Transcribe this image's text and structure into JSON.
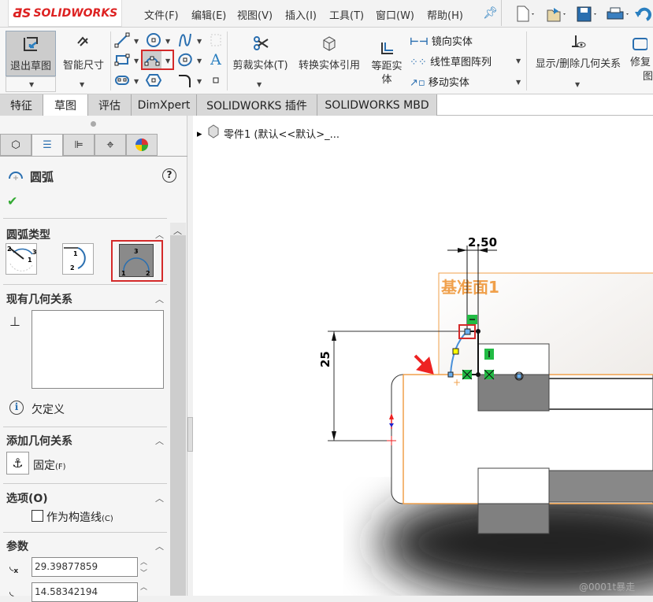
{
  "app": {
    "logo": "SOLIDWORKS",
    "logo_mark": "3DS"
  },
  "menu": [
    {
      "label": "文件(F)"
    },
    {
      "label": "编辑(E)"
    },
    {
      "label": "视图(V)"
    },
    {
      "label": "插入(I)"
    },
    {
      "label": "工具(T)"
    },
    {
      "label": "窗口(W)"
    },
    {
      "label": "帮助(H)"
    }
  ],
  "quick_icons": [
    "pin-icon",
    "new-file-icon",
    "open-file-icon",
    "save-icon",
    "print-icon",
    "undo-icon"
  ],
  "ribbon": {
    "exit_sketch": "退出草图",
    "smart_dim": "智能尺寸",
    "trim": "剪裁实体(T)",
    "convert": "转换实体引用",
    "offset_1": "等距实",
    "offset_2": "体",
    "mirror": "镜向实体",
    "linear_pattern": "线性草图阵列",
    "move": "移动实体",
    "relations": "显示/删除几何关系",
    "repair_1": "修复",
    "repair_2": "图"
  },
  "tabs": [
    {
      "label": "特征"
    },
    {
      "label": "草图"
    },
    {
      "label": "评估"
    },
    {
      "label": "DimXpert"
    },
    {
      "label": "SOLIDWORKS 插件"
    },
    {
      "label": "SOLIDWORKS MBD"
    }
  ],
  "active_tab": "草图",
  "tree": {
    "item": "零件1  (默认<<默认>_..."
  },
  "panel": {
    "title": "圆弧",
    "arc_type": "圆弧类型",
    "existing_relations": "现有几何关系",
    "status": "欠定义",
    "add_relations": "添加几何关系",
    "fix": "固定",
    "fix_key": "(F)",
    "options": "选项(O)",
    "construction": "作为构造线",
    "construction_key": "(C)",
    "construction_checked": false,
    "params": "参数",
    "param_x": "29.39877859",
    "param_y": "14.58342194"
  },
  "canvas": {
    "plane_label": "基准面1",
    "dim_h": "2.50",
    "dim_v": "25",
    "watermark": "@0001t暴走"
  },
  "colors": {
    "accent_red": "#d42a2a",
    "plane_orange": "#f0a04b",
    "sketch_blue": "#4a90d9",
    "relation_green": "#22bb44"
  }
}
